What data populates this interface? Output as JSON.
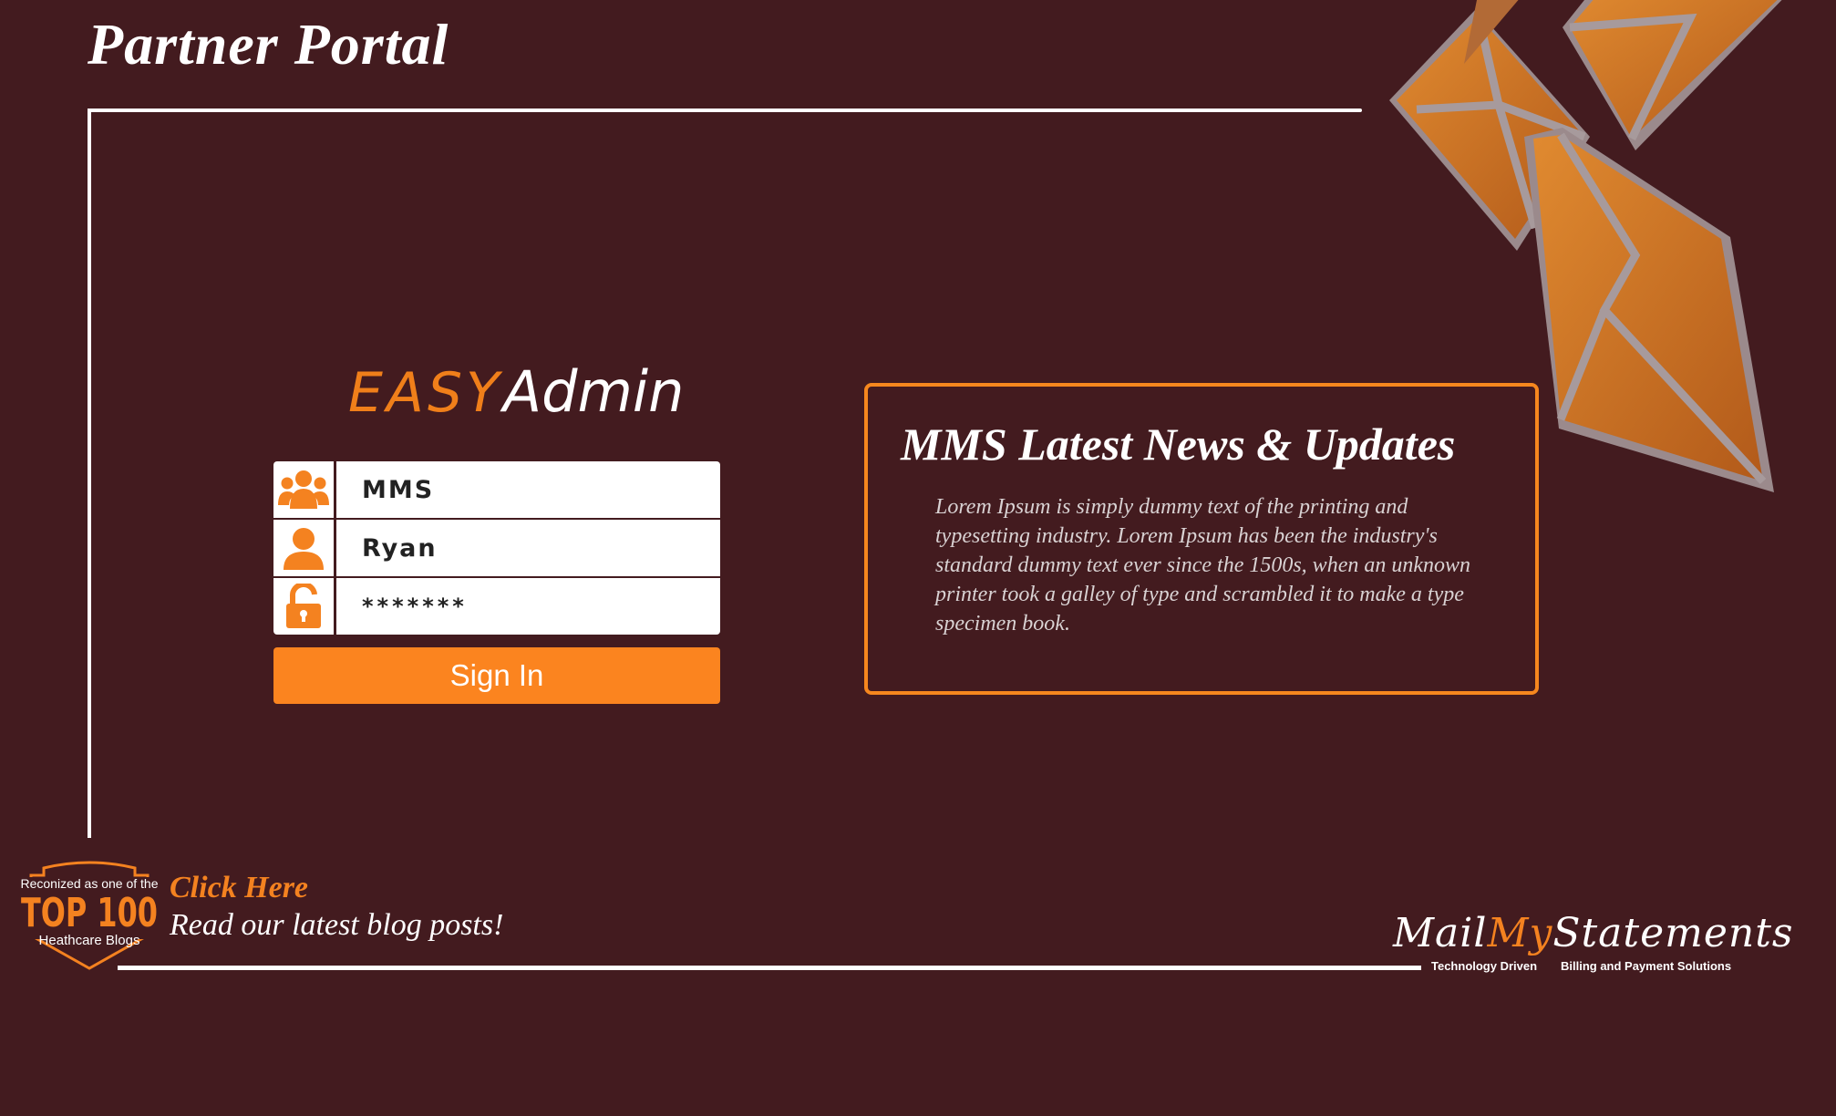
{
  "header": {
    "title": "Partner Portal"
  },
  "logo": {
    "easy": "EASY",
    "admin": "Admin"
  },
  "login": {
    "company_value": "MMS",
    "username_value": "Ryan",
    "password_value": "*******",
    "signin_label": "Sign In"
  },
  "news": {
    "title": "MMS Latest News & Updates",
    "body": "Lorem Ipsum is simply dummy text of the printing and typesetting industry. Lorem Ipsum has been the industry's standard dummy text ever since the 1500s, when an unknown printer took a galley of type and scrambled it to make a type specimen book."
  },
  "badge": {
    "line1": "Reconized as one of the",
    "line2": "TOP 100",
    "line3": "Heathcare Blogs"
  },
  "blog": {
    "click_label": "Click Here",
    "read_label": "Read our latest blog posts!"
  },
  "brand": {
    "mail": "Mail",
    "my": "My",
    "statements": "Statements",
    "tagline_left": "Technology Driven",
    "tagline_right": "Billing and Payment Solutions"
  },
  "colors": {
    "background": "#431b1f",
    "accent": "#f48220",
    "button": "#fb841f"
  },
  "icons": {
    "company": "group-icon",
    "user": "user-icon",
    "password": "unlock-icon",
    "decoration": "envelope-icon"
  }
}
